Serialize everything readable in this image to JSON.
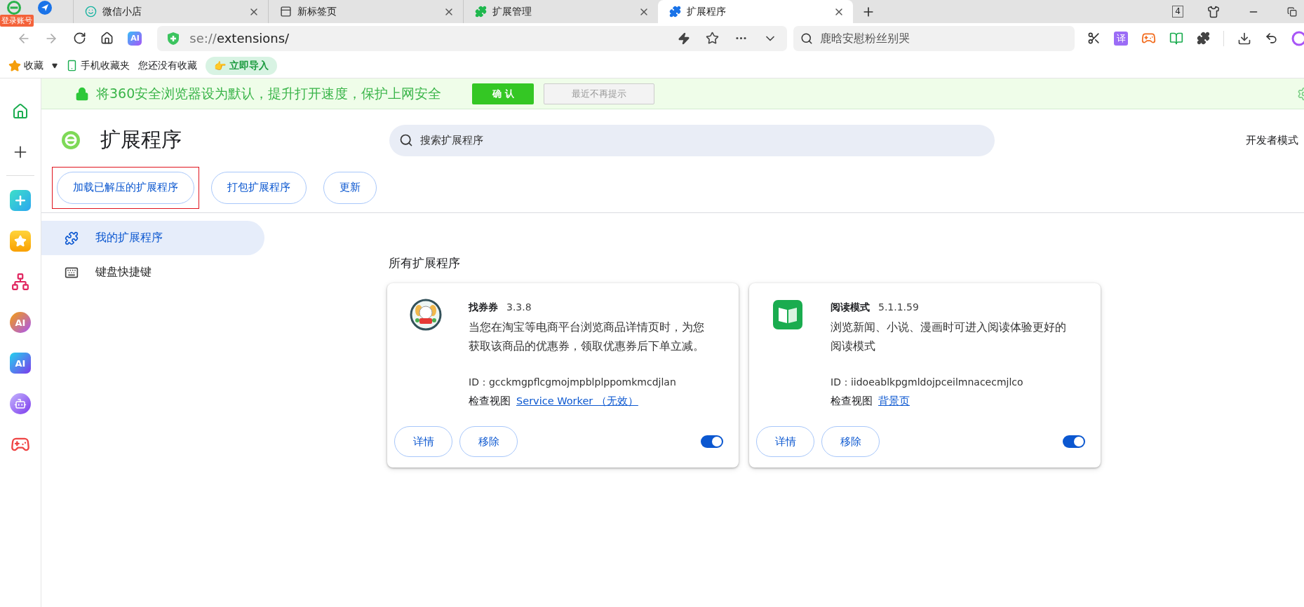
{
  "tab_strip": {
    "login_badge": "登录账号",
    "tab_count": "4",
    "tabs": [
      {
        "title": "微信小店",
        "kind": "wechat",
        "selected": false
      },
      {
        "title": "新标签页",
        "kind": "newtab",
        "selected": false
      },
      {
        "title": "扩展管理",
        "kind": "puzzle-green",
        "selected": false
      },
      {
        "title": "扩展程序",
        "kind": "puzzle-blue",
        "selected": true
      }
    ]
  },
  "toolbar": {
    "ai_label": "AI",
    "address_scheme": "se://",
    "address_path": "extensions/",
    "search_placeholder": "鹿晗安慰粉丝别哭",
    "translate_label": "译"
  },
  "bookmarks": {
    "favorites": "收藏",
    "mobile": "手机收藏夹",
    "empty": "您还没有收藏",
    "import_button": "立即导入",
    "import_icon": "👉"
  },
  "rail": {
    "apps": [
      {
        "kind": "tool"
      },
      {
        "kind": "star"
      },
      {
        "kind": "graph"
      },
      {
        "kind": "ai-ring",
        "label": "AI"
      },
      {
        "kind": "ai-tile",
        "label": "AI"
      },
      {
        "kind": "robot"
      },
      {
        "kind": "game"
      }
    ]
  },
  "banner": {
    "message": "将360安全浏览器设为默认，提升打开速度，保护上网安全",
    "confirm": "确 认",
    "dismiss": "最近不再提示"
  },
  "page": {
    "title": "扩展程序",
    "search_placeholder": "搜索扩展程序",
    "developer_mode": "开发者模式",
    "actions": [
      {
        "label": "加载已解压的扩展程序",
        "highlighted": true
      },
      {
        "label": "打包扩展程序",
        "highlighted": false
      },
      {
        "label": "更新",
        "highlighted": false
      }
    ],
    "nav": [
      {
        "label": "我的扩展程序",
        "kind": "extensions",
        "selected": true
      },
      {
        "label": "键盘快捷键",
        "kind": "keyboard",
        "selected": false
      }
    ],
    "section_title": "所有扩展程序",
    "extensions": [
      {
        "kind": "coupon",
        "name": "找券券",
        "version": "3.3.8",
        "description": "当您在淘宝等电商平台浏览商品详情页时，为您获取该商品的优惠券，领取优惠券后下单立减。",
        "id": "ID：gcckmgpflcgmojmpblplppomkmcdjlan",
        "inspect_label": "检查视图",
        "inspect_link": "Service Worker （无效）",
        "buttons": [
          "详情",
          "移除"
        ],
        "enabled": true
      },
      {
        "kind": "reader",
        "name": "阅读模式",
        "version": "5.1.1.59",
        "description": "浏览新闻、小说、漫画时可进入阅读体验更好的阅读模式",
        "id": "ID：iidoeablkpgmldojpceilmnacecmjlco",
        "inspect_label": "检查视图",
        "inspect_link": "背景页",
        "buttons": [
          "详情",
          "移除"
        ],
        "enabled": true
      }
    ]
  }
}
